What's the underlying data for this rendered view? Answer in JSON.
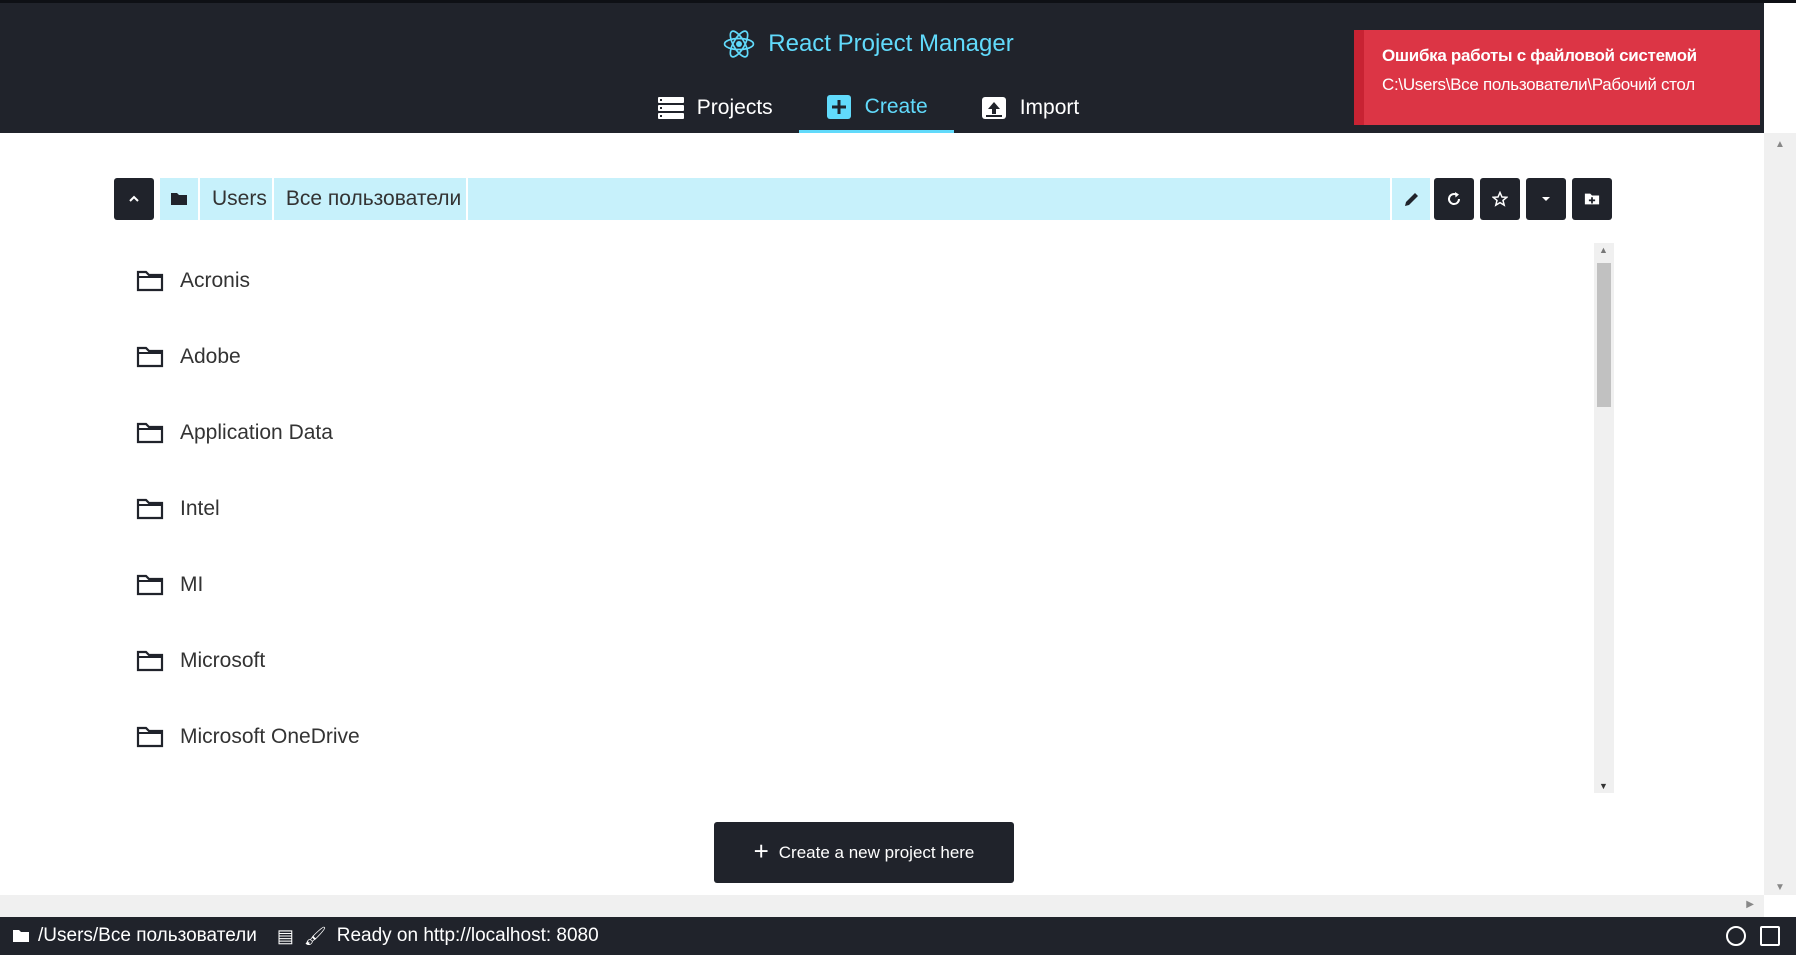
{
  "header": {
    "title": "React Project Manager",
    "nav": [
      {
        "label": "Projects",
        "icon": "list-icon"
      },
      {
        "label": "Create",
        "icon": "plus-square-icon",
        "active": true
      },
      {
        "label": "Import",
        "icon": "upload-box-icon"
      }
    ],
    "accent": "#61dafb",
    "bg": "#20232b"
  },
  "toast": {
    "title": "Ошибка работы с файловой системой",
    "message": "C:\\Users\\Все пользователи\\Рабочий стол",
    "color": "#dc3545"
  },
  "path_bar": {
    "crumbs": [
      "Users",
      "Все пользователи"
    ],
    "bg": "#c7f1fb"
  },
  "folders": [
    "Acronis",
    "Adobe",
    "Application Data",
    "Intel",
    "MI",
    "Microsoft",
    "Microsoft OneDrive"
  ],
  "create_button": {
    "label": "Create a new project here"
  },
  "status_bar": {
    "path": "/Users/Все пользователи",
    "server": "Ready on http://localhost: 8080"
  }
}
